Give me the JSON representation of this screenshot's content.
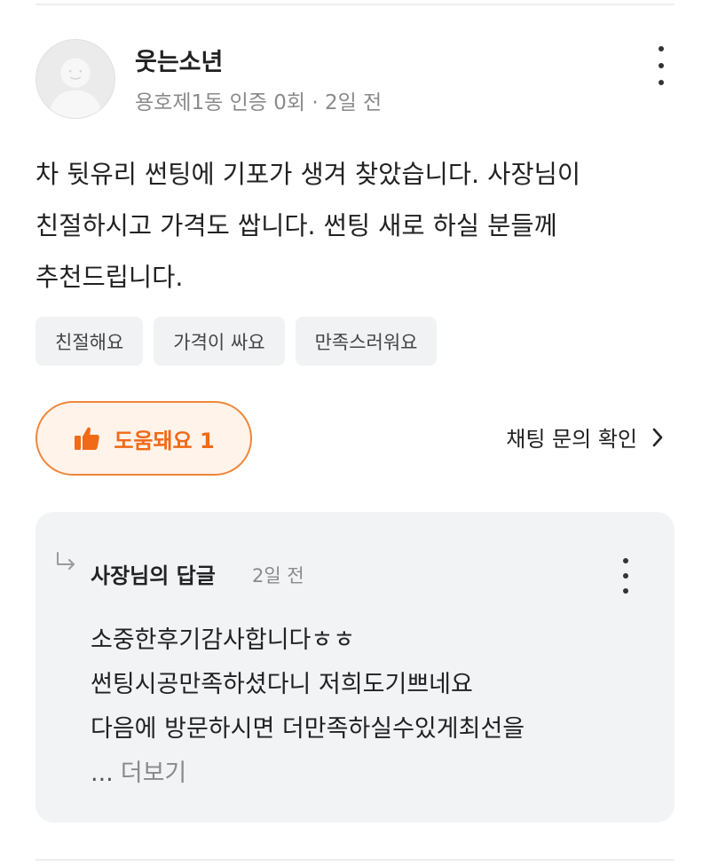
{
  "review": {
    "author": {
      "name": "웃는소년",
      "meta": "용호제1동 인증 0회 · 2일 전"
    },
    "body_lines": [
      "차 뒷유리 썬팅에 기포가 생겨 찾았습니다. 사장님이",
      "친절하시고 가격도 쌉니다. 썬팅 새로 하실 분들께",
      "추천드립니다."
    ],
    "tags": [
      "친절해요",
      "가격이 싸요",
      "만족스러워요"
    ],
    "helpful_button": {
      "label": "도움돼요 1",
      "icon": "thumbs-up-icon",
      "color": "#f06a18"
    },
    "chat_link": {
      "label": "채팅 문의 확인",
      "icon": "chevron-right-icon"
    }
  },
  "reply": {
    "icon": "reply-arrow-icon",
    "author": "사장님의 답글",
    "time": "2일 전",
    "body_lines": [
      "소중한후기감사합니다ㅎㅎ",
      "썬팅시공만족하셨다니 저희도기쁘네요",
      "다음에 방문하시면 더만족하실수있게최선을"
    ],
    "ellipsis": "...",
    "see_more": "더보기"
  },
  "colors": {
    "accent": "#f06a18",
    "accent_border": "#f0873a",
    "accent_bg": "#fff3ea",
    "tag_bg": "#f1f2f4",
    "card_bg": "#f2f3f5",
    "muted_text": "#8a8a8a"
  }
}
